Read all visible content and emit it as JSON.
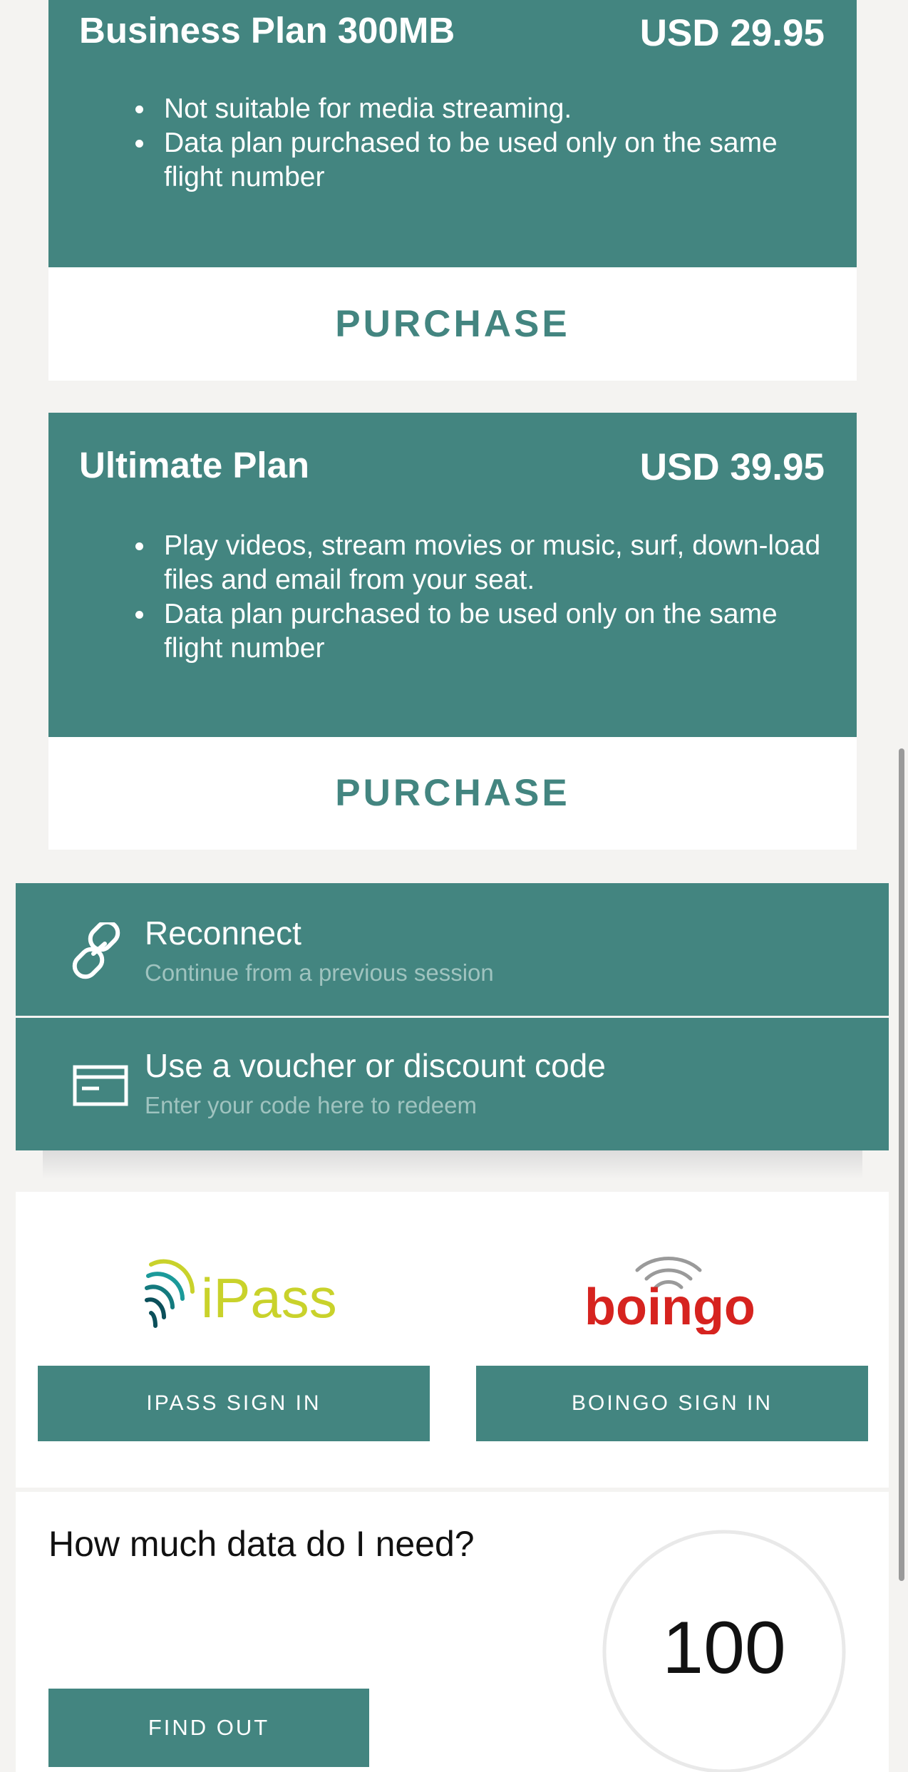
{
  "plans": [
    {
      "name": "Business Plan 300MB",
      "price": "USD 29.95",
      "features": [
        "Not suitable for media streaming.",
        "Data plan purchased to be used only on the same flight number"
      ],
      "purchase_label": "PURCHASE"
    },
    {
      "name": "Ultimate Plan",
      "price": "USD 39.95",
      "features": [
        "Play videos, stream movies or music, surf, down-load files and email from your seat.",
        "Data plan purchased to be used only on the same flight number"
      ],
      "purchase_label": "PURCHASE"
    }
  ],
  "options": {
    "reconnect": {
      "title": "Reconnect",
      "subtitle": "Continue from a previous session",
      "icon": "link-icon"
    },
    "voucher": {
      "title": "Use a voucher or discount code",
      "subtitle": "Enter your code here to redeem",
      "icon": "card-icon"
    }
  },
  "partners": {
    "ipass": {
      "logo_text": "iPass",
      "button_label": "IPASS SIGN IN"
    },
    "boingo": {
      "logo_text": "boingo",
      "button_label": "BOINGO SIGN IN"
    }
  },
  "data_calculator": {
    "title": "How much data do I need?",
    "value": "100",
    "button_label": "FIND OUT"
  },
  "colors": {
    "accent": "#438580",
    "background": "#f4f3f1",
    "ipass_yellow": "#c9d22b",
    "ipass_teal": "#1b9a9a",
    "boingo_red": "#d6231f"
  }
}
